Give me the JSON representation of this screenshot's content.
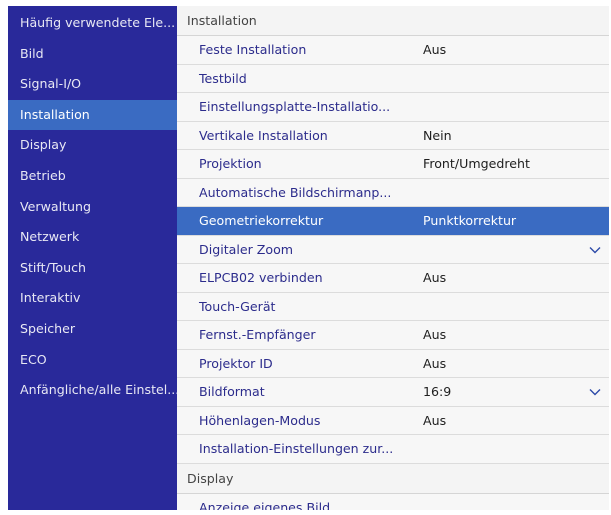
{
  "sidebar": {
    "items": [
      {
        "label": "Häufig verwendete Ele..."
      },
      {
        "label": "Bild"
      },
      {
        "label": "Signal-I/O"
      },
      {
        "label": "Installation"
      },
      {
        "label": "Display"
      },
      {
        "label": "Betrieb"
      },
      {
        "label": "Verwaltung"
      },
      {
        "label": "Netzwerk"
      },
      {
        "label": "Stift/Touch"
      },
      {
        "label": "Interaktiv"
      },
      {
        "label": "Speicher"
      },
      {
        "label": "ECO"
      },
      {
        "label": "Anfängliche/alle Einstel..."
      }
    ],
    "active_index": 3
  },
  "main": {
    "section_title": "Installation",
    "rows": [
      {
        "label": "Feste Installation",
        "value": "Aus"
      },
      {
        "label": "Testbild",
        "value": ""
      },
      {
        "label": "Einstellungsplatte-Installatio...",
        "value": ""
      },
      {
        "label": "Vertikale Installation",
        "value": "Nein"
      },
      {
        "label": "Projektion",
        "value": "Front/Umgedreht"
      },
      {
        "label": "Automatische Bildschirmanp...",
        "value": ""
      },
      {
        "label": "Geometriekorrektur",
        "value": "Punktkorrektur"
      },
      {
        "label": "Digitaler Zoom",
        "value": ""
      },
      {
        "label": "ELPCB02 verbinden",
        "value": "Aus"
      },
      {
        "label": "Touch-Gerät",
        "value": ""
      },
      {
        "label": "Fernst.-Empfänger",
        "value": "Aus"
      },
      {
        "label": "Projektor ID",
        "value": "Aus"
      },
      {
        "label": "Bildformat",
        "value": "16:9"
      },
      {
        "label": "Höhenlagen-Modus",
        "value": "Aus"
      },
      {
        "label": "Installation-Einstellungen zur...",
        "value": ""
      }
    ],
    "selected_index": 6,
    "section2_title": "Display",
    "rows2": [
      {
        "label": "Anzeige eigenes Bild"
      }
    ]
  },
  "icons": {
    "digital_zoom_expand": "chevron-down-icon",
    "bildformat_expand": "chevron-down-icon"
  },
  "colors": {
    "sidebar_bg": "#29299a",
    "highlight": "#3a6bc2",
    "item_text": "#2c2c8c"
  }
}
